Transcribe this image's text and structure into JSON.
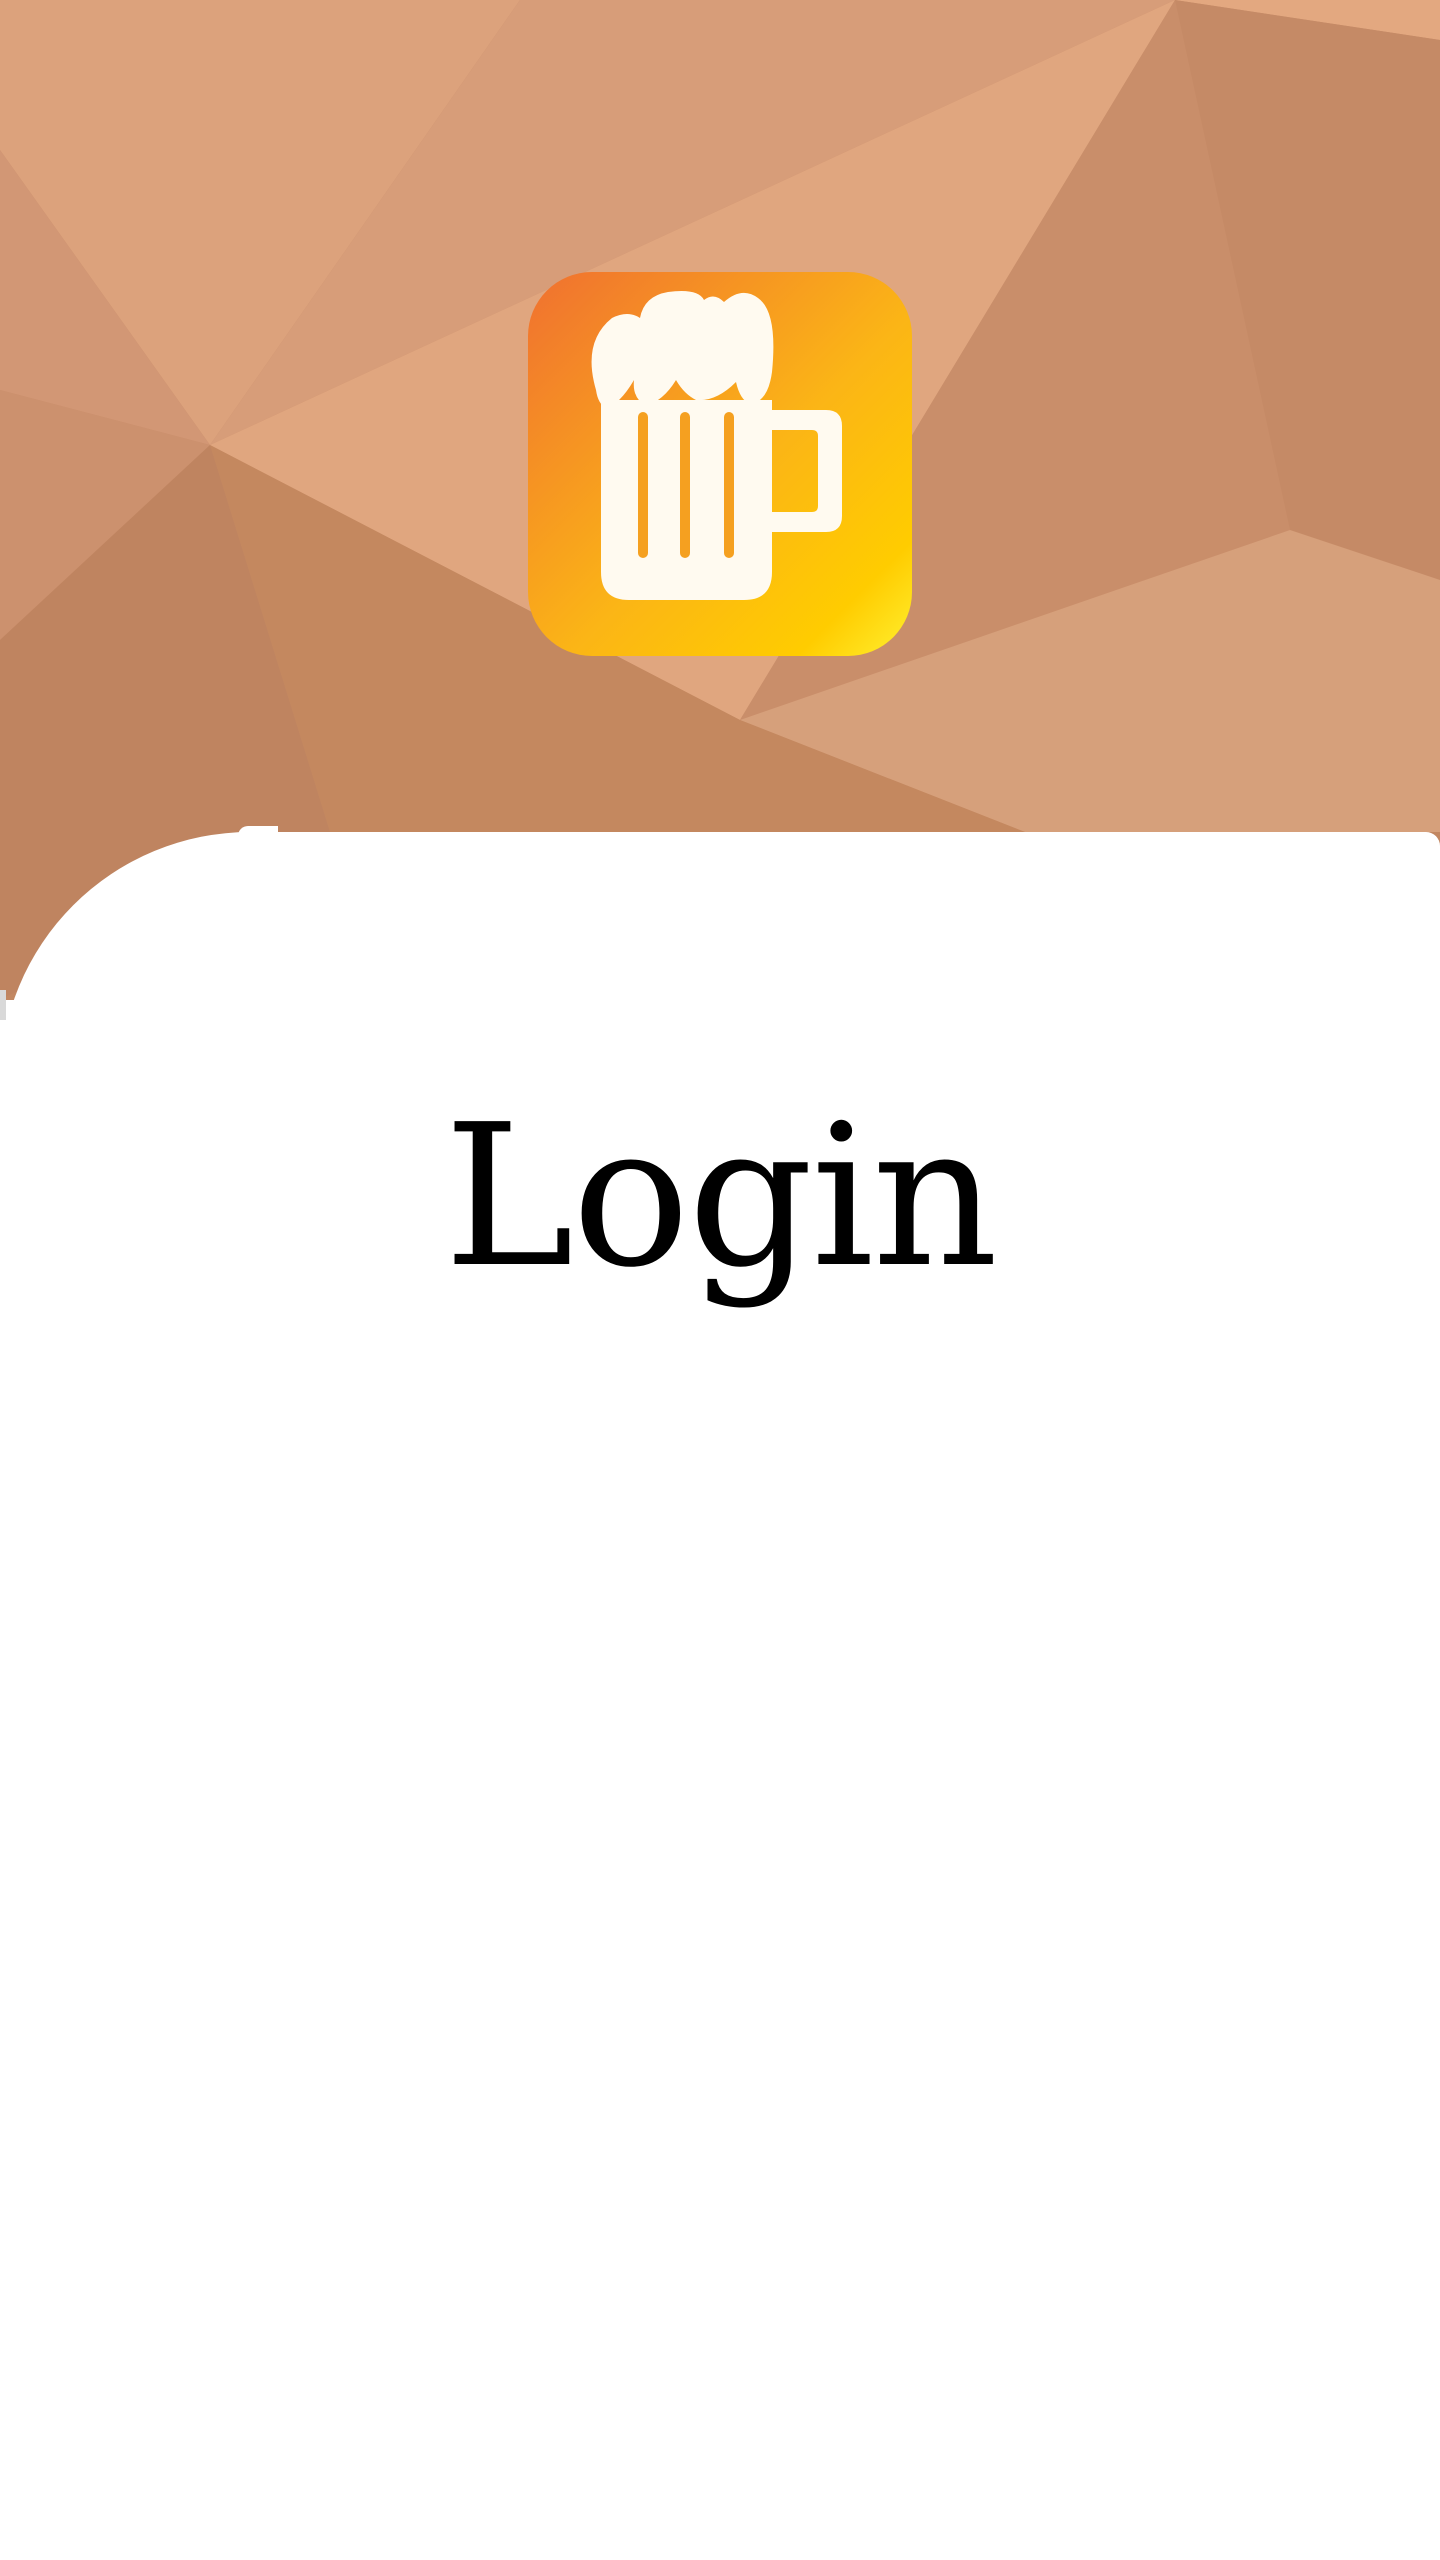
{
  "screen": {
    "title": "Login"
  },
  "header": {
    "background": "low-poly-copper-pattern",
    "logo_icon": "beer-mug-icon"
  },
  "colors": {
    "background_peach_light": "#e3a880",
    "background_peach_mid": "#d49b77",
    "background_copper_dark": "#c08461",
    "logo_gradient_start": "#f07030",
    "logo_gradient_end": "#ffcc00",
    "logo_gradient_highlight": "#fff030",
    "mug_fill": "#fffaf0",
    "card_background": "#ffffff",
    "title_text": "#000000"
  }
}
